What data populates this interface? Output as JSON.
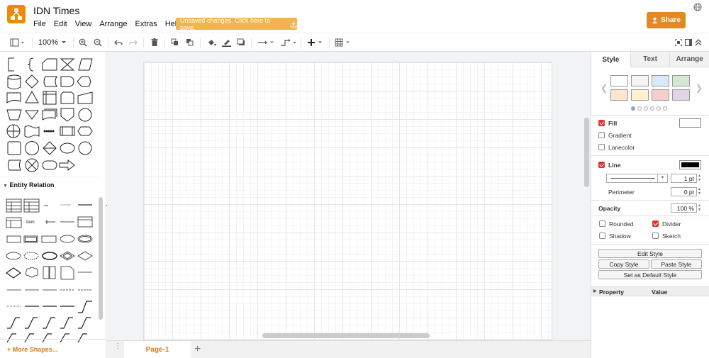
{
  "app": {
    "title": "IDN Times",
    "unsaved_notice": "Unsaved changes. Click here to save.",
    "share_label": "Share"
  },
  "menu": [
    "File",
    "Edit",
    "View",
    "Arrange",
    "Extras",
    "Help"
  ],
  "toolbar": {
    "zoom": "100%"
  },
  "sidebar": {
    "section_title": "Entity Relation",
    "more_shapes": "+ More Shapes...",
    "er_item_label": "Item"
  },
  "pages": {
    "tabs": [
      "Page-1"
    ],
    "add_icon": "+"
  },
  "panel": {
    "tabs": [
      "Style",
      "Text",
      "Arrange"
    ],
    "active_tab": "Style",
    "swatch_colors": [
      "#ffffff",
      "#f5f5f5",
      "#dae8fc",
      "#d5e8d4",
      "#ffe6cc",
      "#fff2cc",
      "#f8cecc",
      "#e1d5e7"
    ],
    "fill_label": "Fill",
    "gradient_label": "Gradient",
    "lanecolor_label": "Lanecolor",
    "line_label": "Line",
    "line_width": "1 pt",
    "perimeter_label": "Perimeter",
    "perimeter_value": "0 pt",
    "opacity_label": "Opacity",
    "opacity_value": "100 %",
    "rounded_label": "Rounded",
    "divider_label": "Divider",
    "shadow_label": "Shadow",
    "sketch_label": "Sketch",
    "edit_style": "Edit Style",
    "copy_style": "Copy Style",
    "paste_style": "Paste Style",
    "default_style": "Set as Default Style",
    "property_col": "Property",
    "value_col": "Value",
    "fill_color": "#ffffff",
    "line_color": "#000000"
  },
  "colors": {
    "accent": "#e28924",
    "unsaved_bg": "#f2b44d",
    "check_red": "#d33333"
  }
}
